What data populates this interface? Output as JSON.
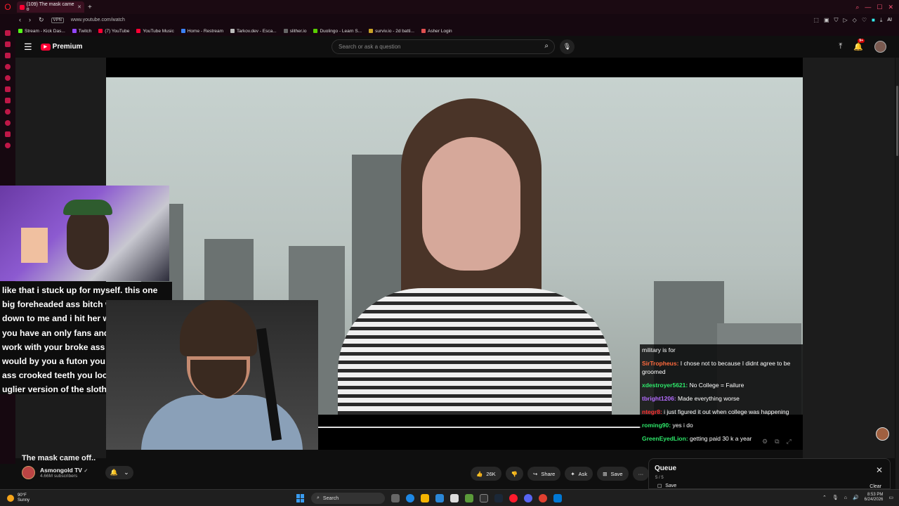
{
  "browser": {
    "tab_title": "(109) The mask came o",
    "url": "www.youtube.com/watch",
    "vpn_label": "VPN",
    "ai_label": "AI",
    "bookmarks": [
      "Stream - Kick Das...",
      "Twitch",
      "(7) YouTube",
      "YouTube Music",
      "Home - Restream",
      "Tarkov.dev - Esca...",
      "slither.io",
      "Duolingo - Learn S...",
      "surviv.io - 2d batti...",
      "Asher Login"
    ],
    "bookmark_colors": [
      "#53fc18",
      "#9146ff",
      "#ff0033",
      "#ff0033",
      "#3b82f6",
      "#bbbbbb",
      "#666666",
      "#58cc02",
      "#c9a227",
      "#e05050"
    ]
  },
  "youtube": {
    "brand": "Premium",
    "search_placeholder": "Search or ask a question",
    "notif_count": "9+",
    "video_title": "The mask came off..",
    "channel_name": "Asmongold TV",
    "channel_subs": "4.66M subscribers",
    "likes": "26K",
    "share_label": "Share",
    "ask_label": "Ask",
    "save_label": "Save",
    "queue": {
      "title": "Queue",
      "count": "5 / 5",
      "save": "Save",
      "clear": "Clear"
    }
  },
  "caption_text": "like that i stuck up for myself. this one big foreheaded ass bitch was talking down to me and i hit her with thats why you have an only fans and still have to work with your broke ass not even trump would by you a futon you got that falt ass crooked teeth you look like the uglier version of the sloth",
  "chat": [
    {
      "name": "",
      "color": "#ffffff",
      "text": "military is for"
    },
    {
      "name": "SirTropheus:",
      "color": "#ff6a3d",
      "text": "I chose not to because I didnt agree to be groomed"
    },
    {
      "name": "xdestroyer5621:",
      "color": "#2ee86a",
      "text": "No College = Failure"
    },
    {
      "name": "tbright1206:",
      "color": "#b46cff",
      "text": "Made everything worse"
    },
    {
      "name": "ntegr8:",
      "color": "#ff3030",
      "text": "i just figured it out when college was happening"
    },
    {
      "name": "roming90:",
      "color": "#2ee86a",
      "text": "yes i do"
    },
    {
      "name": "GreenEyedLion:",
      "color": "#2ee86a",
      "text": "getting paid 30 k a year"
    }
  ],
  "taskbar": {
    "temp": "90°F",
    "weather": "Sunny",
    "search_label": "Search",
    "time": "8:53 PM",
    "date": "6/24/2026"
  }
}
